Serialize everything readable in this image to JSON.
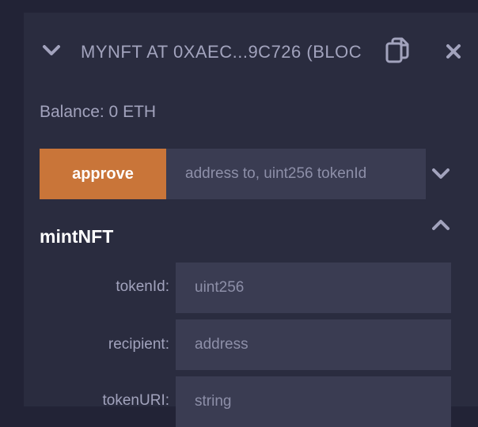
{
  "contract": {
    "title": "MYNFT AT 0XAEC...9C726 (BLOC",
    "balance": "Balance: 0 ETH"
  },
  "approve": {
    "label": "approve",
    "placeholder": "address to, uint256 tokenId"
  },
  "mint": {
    "title": "mintNFT",
    "fields": [
      {
        "label": "tokenId:",
        "placeholder": "uint256"
      },
      {
        "label": "recipient:",
        "placeholder": "address"
      },
      {
        "label": "tokenURI:",
        "placeholder": "string"
      }
    ]
  },
  "icons": {
    "collapse": "chevron-down-icon",
    "copy": "copy-icon",
    "close": "close-icon",
    "expand": "chevron-down-icon",
    "collapse_section": "chevron-up-icon"
  },
  "colors": {
    "background": "#222336",
    "panel": "#2a2c3f",
    "input": "#3a3c52",
    "accent": "#c97539",
    "muted_text": "#a2a3bd"
  }
}
